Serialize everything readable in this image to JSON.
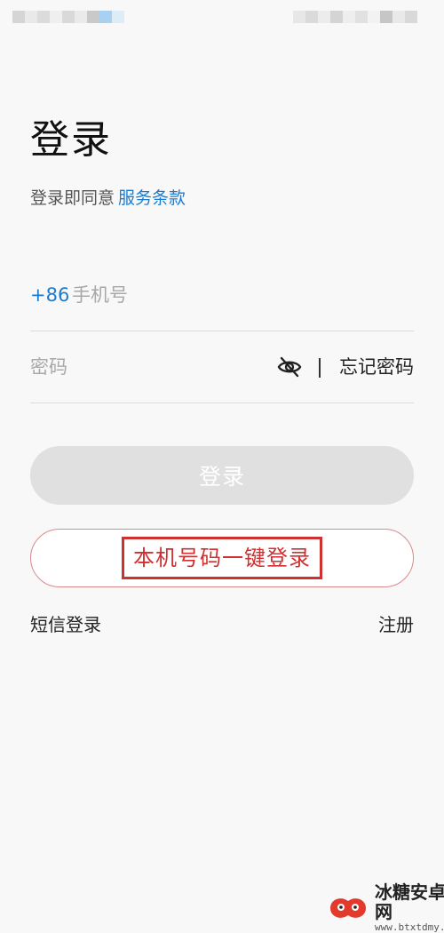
{
  "title": "登录",
  "agreement": {
    "prefix": "登录即同意",
    "link": "服务条款"
  },
  "phone": {
    "country_code": "+86",
    "placeholder": "手机号",
    "value": ""
  },
  "password": {
    "placeholder": "密码",
    "value": "",
    "forgot_label": "忘记密码"
  },
  "buttons": {
    "login": "登录",
    "one_key_login": "本机号码一键登录"
  },
  "links": {
    "sms_login": "短信登录",
    "register": "注册"
  },
  "icons": {
    "password_visibility": "eye-off-icon"
  },
  "colors": {
    "accent": "#1b7bd1",
    "login_disabled_bg": "#e0e0e0",
    "highlight_box": "#d03030"
  },
  "watermark": {
    "title": "冰糖安卓网",
    "url": "www.btxtdmy.com"
  }
}
